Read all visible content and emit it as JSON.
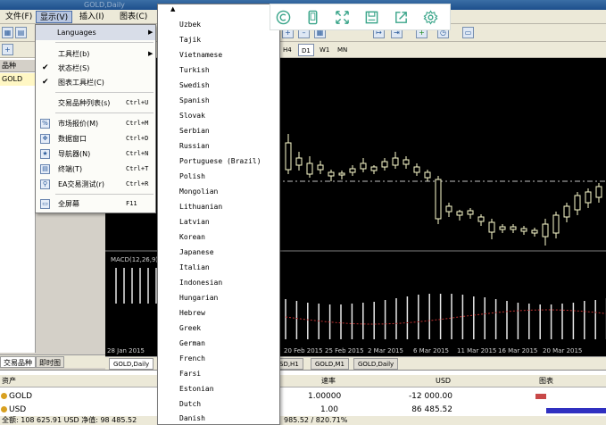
{
  "titlebar": {
    "text": "GOLD,Daily"
  },
  "menubar": {
    "items": [
      {
        "label": "文件(F)"
      },
      {
        "label": "显示(V)"
      },
      {
        "label": "插入(I)"
      },
      {
        "label": "图表(C)"
      }
    ]
  },
  "view_menu": {
    "items": [
      {
        "label": "Languages",
        "shortcut": "",
        "submenu": true,
        "icon": ""
      },
      {
        "label": "工具栏(b)",
        "shortcut": "",
        "submenu": true,
        "icon": ""
      },
      {
        "label": "状态栏(S)",
        "shortcut": "",
        "checked": true,
        "icon": ""
      },
      {
        "label": "图表工具栏(C)",
        "shortcut": "",
        "checked": true,
        "icon": ""
      },
      {
        "label": "交易品种列表(s)",
        "shortcut": "Ctrl+U",
        "icon": ""
      },
      {
        "label": "市场报价(M)",
        "shortcut": "Ctrl+M",
        "icon": "market-watch-icon"
      },
      {
        "label": "数据窗口",
        "shortcut": "Ctrl+D",
        "icon": "crosshair-icon"
      },
      {
        "label": "导航器(N)",
        "shortcut": "Ctrl+N",
        "icon": "navigator-icon"
      },
      {
        "label": "终端(T)",
        "shortcut": "Ctrl+T",
        "icon": "terminal-icon"
      },
      {
        "label": "EA交易测试(r)",
        "shortcut": "Ctrl+R",
        "icon": "tester-icon"
      },
      {
        "label": "全屏幕",
        "shortcut": "F11",
        "icon": "fullscreen-icon"
      }
    ]
  },
  "languages": [
    "Uzbek",
    "Tajik",
    "Vietnamese",
    "Turkish",
    "Swedish",
    "Spanish",
    "Slovak",
    "Serbian",
    "Russian",
    "Portuguese (Brazil)",
    "Polish",
    "Mongolian",
    "Lithuanian",
    "Latvian",
    "Korean",
    "Japanese",
    "Italian",
    "Indonesian",
    "Hungarian",
    "Hebrew",
    "Greek",
    "German",
    "French",
    "Farsi",
    "Estonian",
    "Dutch",
    "Danish"
  ],
  "timeframes": [
    "H4",
    "D1",
    "W1",
    "MN"
  ],
  "timeframe_selected": "D1",
  "navigator": {
    "header": "品种",
    "item": "GOLD"
  },
  "left_tabs": [
    "交易品种",
    "即时图"
  ],
  "macd_label": "MACD(12,26,9)",
  "date_axis": [
    "28 Jan 2015",
    "20 Feb 2015",
    "25 Feb 2015",
    "2 Mar 2015",
    "6 Mar 2015",
    "11 Mar 2015",
    "16 Mar 2015",
    "20 Mar 2015"
  ],
  "chart_tabs": [
    "GOLD,Daily",
    "SD,H1",
    "GOLD,M1",
    "GOLD,Daily"
  ],
  "terminal": {
    "headers": {
      "asset": "资产",
      "rate": "速率",
      "usd": "USD",
      "chart": "图表"
    },
    "rows": [
      {
        "name": "GOLD",
        "qty": "1.00",
        "rate": "1.00000",
        "usd": "-12 000.00"
      },
      {
        "name": "USD",
        "qty": "1.00",
        "rate": "1.00",
        "usd": "86 485.52"
      }
    ]
  },
  "status": {
    "left": "全额: 108 625.91 USD  净值: 98 485.52",
    "right": "985.52 / 820.71%"
  },
  "colors": {
    "bull": "#ffffd0",
    "chart_bg": "#000000",
    "bar_red": "#c84848",
    "bar_blue": "#3030c0",
    "menu_highlight": "#d8dde8"
  },
  "floating_toolbar": [
    "copyright-icon",
    "phone-icon",
    "expand-icon",
    "save-icon",
    "share-icon",
    "settings-icon"
  ]
}
